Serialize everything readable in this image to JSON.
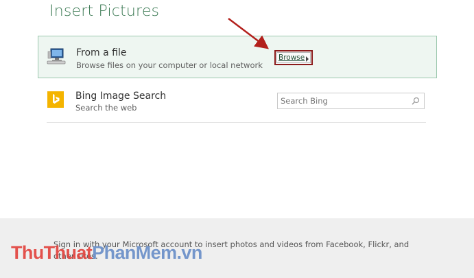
{
  "dialog": {
    "title": "Insert Pictures"
  },
  "sources": {
    "file": {
      "title": "From a file",
      "subtitle": "Browse files on your computer or local network",
      "browse_label": "Browse",
      "icon": "computer-icon"
    },
    "bing": {
      "title": "Bing Image Search",
      "subtitle": "Search the web",
      "search_placeholder": "Search Bing",
      "icon": "bing-logo-icon"
    }
  },
  "footer": {
    "text": "Sign in with your Microsoft account to insert photos and videos from Facebook, Flickr, and other sites."
  },
  "watermark": {
    "part1": "ThuThuat",
    "part2": "PhanMem",
    "part3": ".vn"
  },
  "colors": {
    "title": "#3c7a54",
    "row_highlight": "#eef6f1",
    "row_border": "#9ac7ad",
    "annotation_red": "#b3201c",
    "bing_yellow": "#f4b400"
  }
}
